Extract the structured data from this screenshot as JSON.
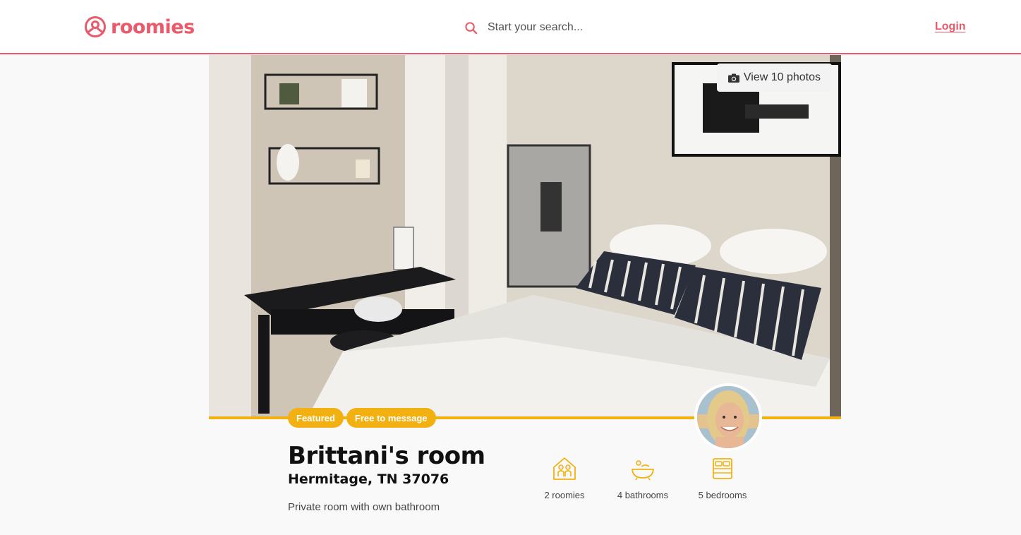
{
  "header": {
    "logo_text": "roomies",
    "search_placeholder": "Start your search...",
    "login_label": "Login"
  },
  "colors": {
    "brand": "#ea5a6a",
    "accent": "#f2b111",
    "background": "#f9f9f9"
  },
  "gallery": {
    "view_photos_label": "View 10 photos"
  },
  "badges": [
    "Featured",
    "Free to message"
  ],
  "listing": {
    "title": "Brittani's room",
    "location": "Hermitage, TN 37076",
    "description": "Private room with own bathroom"
  },
  "stats": [
    {
      "icon": "roomies-icon",
      "label": "2 roomies"
    },
    {
      "icon": "bathtub-icon",
      "label": "4 bathrooms"
    },
    {
      "icon": "bed-icon",
      "label": "5 bedrooms"
    }
  ]
}
